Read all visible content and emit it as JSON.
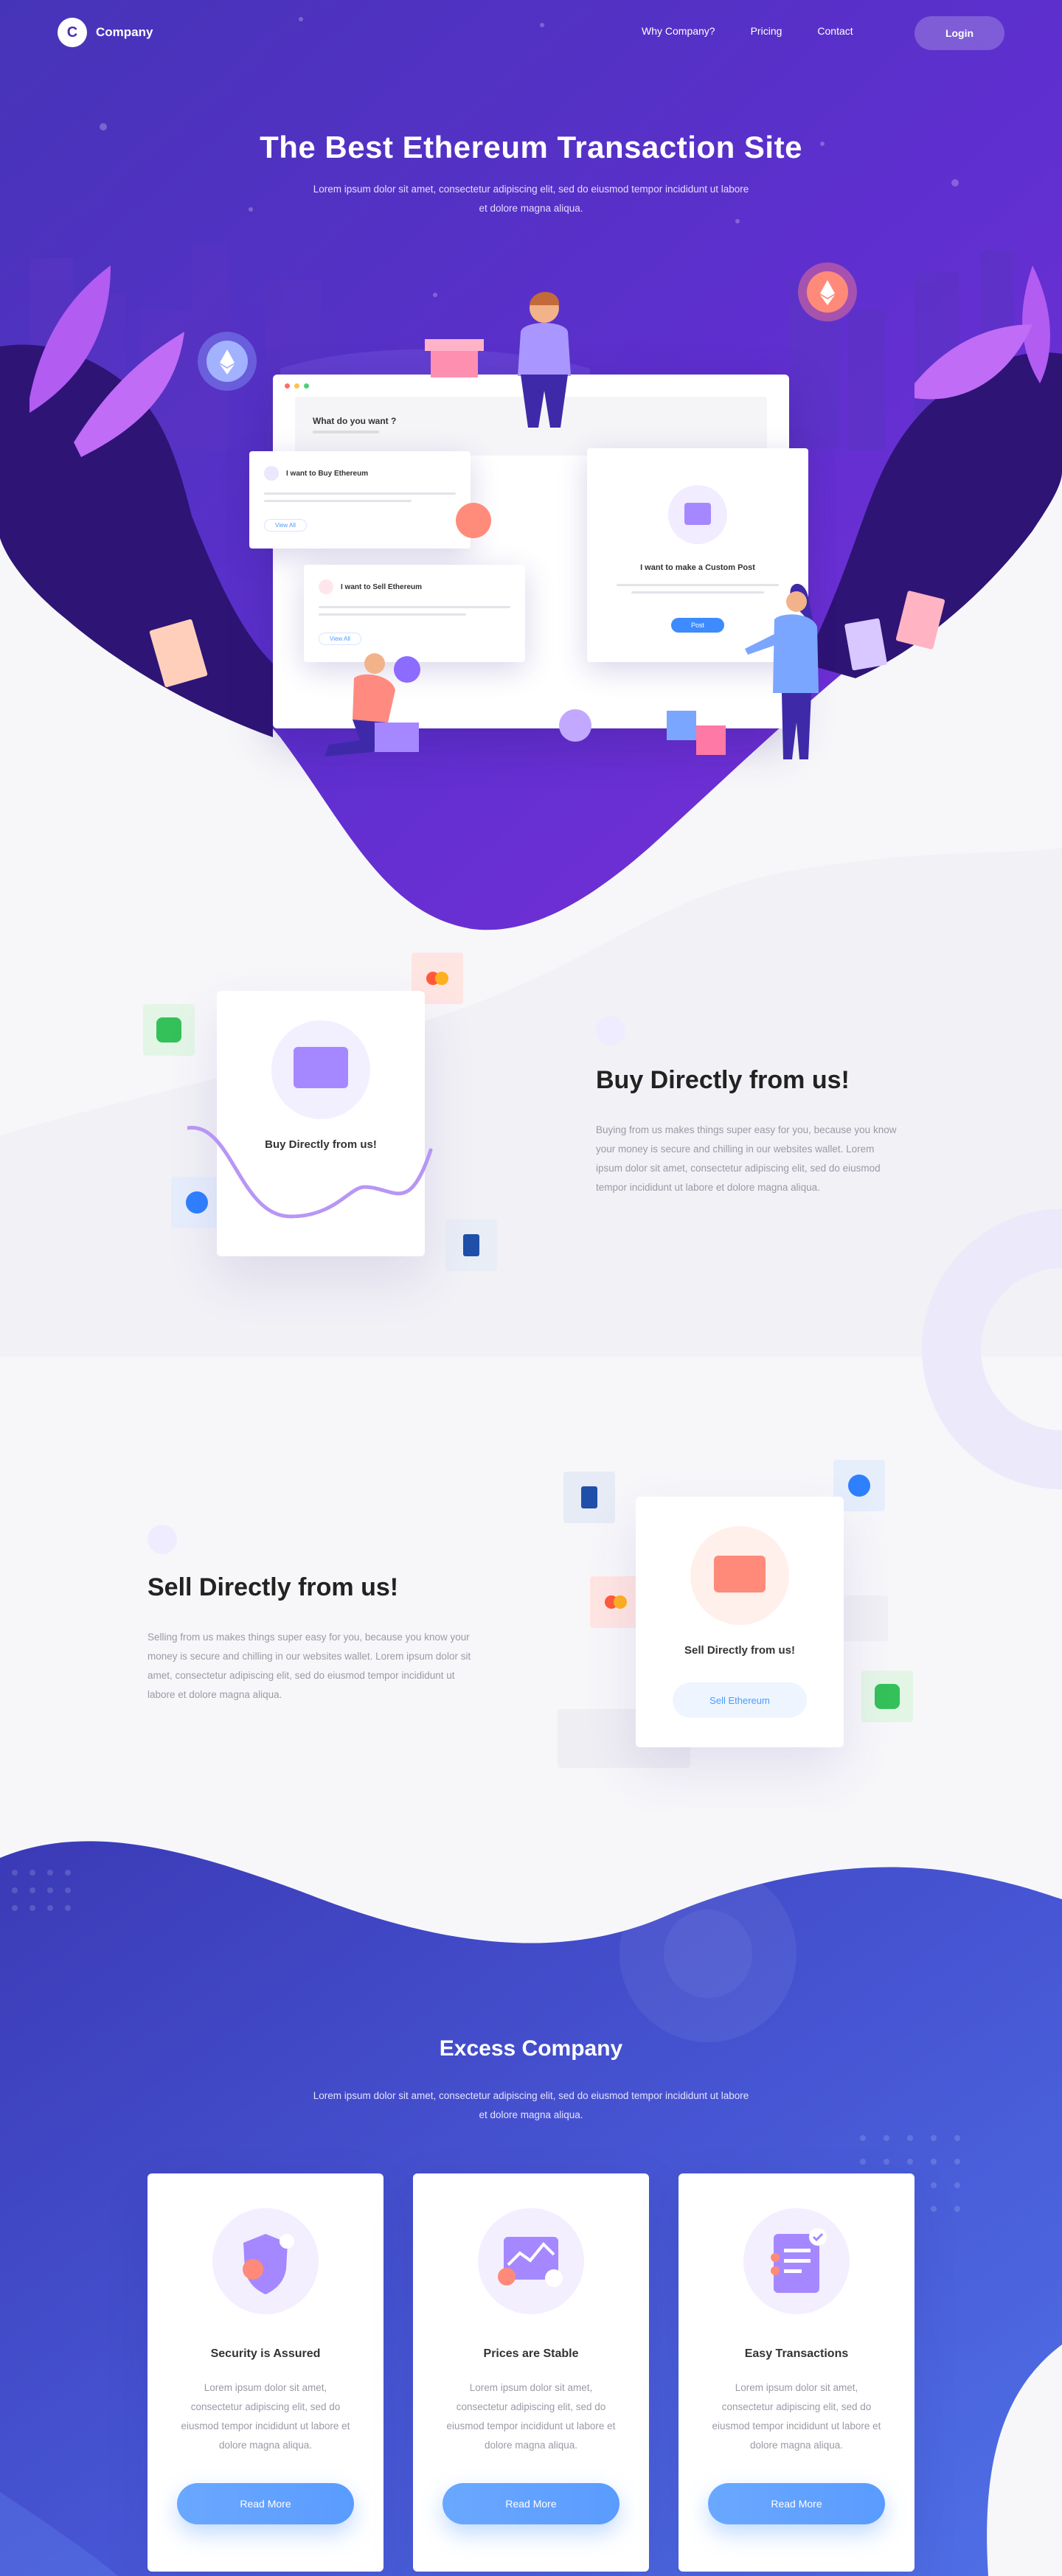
{
  "nav": {
    "brand_initial": "C",
    "brand": "Company",
    "links": [
      "Why Company?",
      "Pricing",
      "Contact"
    ],
    "login": "Login"
  },
  "hero": {
    "title": "The Best Ethereum Transaction Site",
    "subtitle": "Lorem ipsum dolor sit amet, consectetur adipiscing elit, sed do eiusmod tempor incididunt ut labore et dolore magna aliqua.",
    "window_question": "What do you want ?",
    "buy_card": "I want to Buy Ethereum",
    "sell_card": "I want to Sell Ethereum",
    "view_all": "View All",
    "custom_card": "I want to make a Custom Post",
    "post_button": "Post"
  },
  "buy": {
    "card_label": "Buy Directly from us!",
    "title": "Buy Directly from us!",
    "text": "Buying from us makes things super easy for you, because you know your money is secure and chilling in our websites  wallet. Lorem ipsum dolor sit amet, consectetur adipiscing elit, sed do eiusmod tempor incididunt ut labore et dolore magna aliqua."
  },
  "sell": {
    "title": "Sell Directly from us!",
    "text": "Selling from us makes things super easy for you, because you know your money is secure and chilling in our websites  wallet. Lorem ipsum dolor sit amet, consectetur adipiscing elit, sed do eiusmod tempor incididunt ut labore et dolore magna aliqua.",
    "card_label": "Sell Directly from us!",
    "card_button": "Sell Ethereum"
  },
  "excess": {
    "title": "Excess Company",
    "subtitle": "Lorem ipsum dolor sit amet, consectetur adipiscing elit, sed do eiusmod tempor incididunt ut labore et dolore magna aliqua.",
    "features": [
      {
        "title": "Security is Assured",
        "text": "Lorem ipsum dolor sit amet, consectetur adipiscing elit, sed do eiusmod tempor incididunt ut labore et dolore magna aliqua.",
        "button": "Read More",
        "icon": "shield-icon"
      },
      {
        "title": "Prices are Stable",
        "text": "Lorem ipsum dolor sit amet, consectetur adipiscing elit, sed do eiusmod tempor incididunt ut labore et dolore magna aliqua.",
        "button": "Read More",
        "icon": "chart-icon"
      },
      {
        "title": "Easy Transactions",
        "text": "Lorem ipsum dolor sit amet, consectetur adipiscing elit, sed do eiusmod tempor incididunt ut labore et dolore magna aliqua.",
        "button": "Read More",
        "icon": "document-check-icon"
      }
    ]
  },
  "colors": {
    "hero_top": "#4a2fb5",
    "hero_purple": "#7a2fd6",
    "accent_blue": "#5a9bff",
    "excess_blue": "#3f4fd0"
  }
}
